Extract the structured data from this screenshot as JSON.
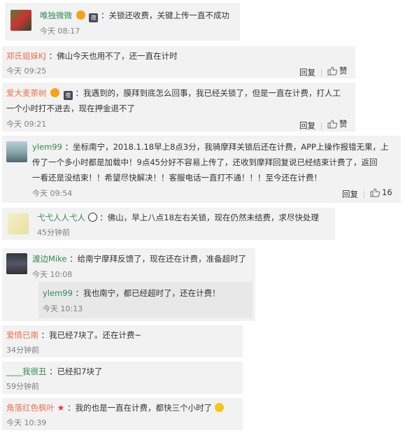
{
  "comments": [
    {
      "user": "唯独微微",
      "text": "：关锁还收费，关键上传一直不成功",
      "time": "今天 08:17"
    },
    {
      "user": "郑氏姐妹KJ",
      "text": "：佛山今天也用不了，还一直在计时",
      "time": "今天 09:25",
      "reply": "回复",
      "like": "赞"
    },
    {
      "user": "爱大麦茶树",
      "text_line1": "：我遇到的，膜拜到底怎么回事，我已经关锁了，但是一直在计费，打人工",
      "text_line2": "一个小时打不进去，现在押金退不了",
      "time": "今天 09:21",
      "reply": "回复",
      "like": "赞"
    },
    {
      "user": "ylem99",
      "text_line1": "：坐标南宁，2018.1.18早上8点3分，我骑摩拜关锁后还在计费，APP上操作报错无果，上",
      "text_line2": "传了一个多小时都是加载中！9点45分好不容易上传了，还收到摩拜回复说已经结束计费了，返回",
      "text_line3": "一看还是没结束！！希望尽快解决！！客服电话一直打不通！！！至今还在计费！",
      "time": "今天 09:54",
      "reply": "回复",
      "like_count": "16"
    },
    {
      "user": "弋弋人人弋人",
      "text": "：佛山，早上八点18左右关锁，现在仍然未结费，求尽快处理",
      "time": "45分钟前"
    },
    {
      "user": "渡边Mike",
      "text": "：给南宁摩拜反馈了，现在还在计费，准备超时了",
      "time": "今天 10:08",
      "nested": {
        "user": "ylem99",
        "text": "：我也南宁，都已经超时了，还在计费！",
        "time": "今天 10:13"
      }
    },
    {
      "user": "爱情已南",
      "text": "：我已经7块了。还在计费~",
      "time": "34分钟前"
    },
    {
      "user": "____我很丑",
      "text": "：已经扣7块了",
      "time": "59分钟前"
    },
    {
      "user": "角落红色枫叶",
      "text": "：我的也是一直在计费，都快三个小时了",
      "time": "今天 10:39"
    }
  ]
}
